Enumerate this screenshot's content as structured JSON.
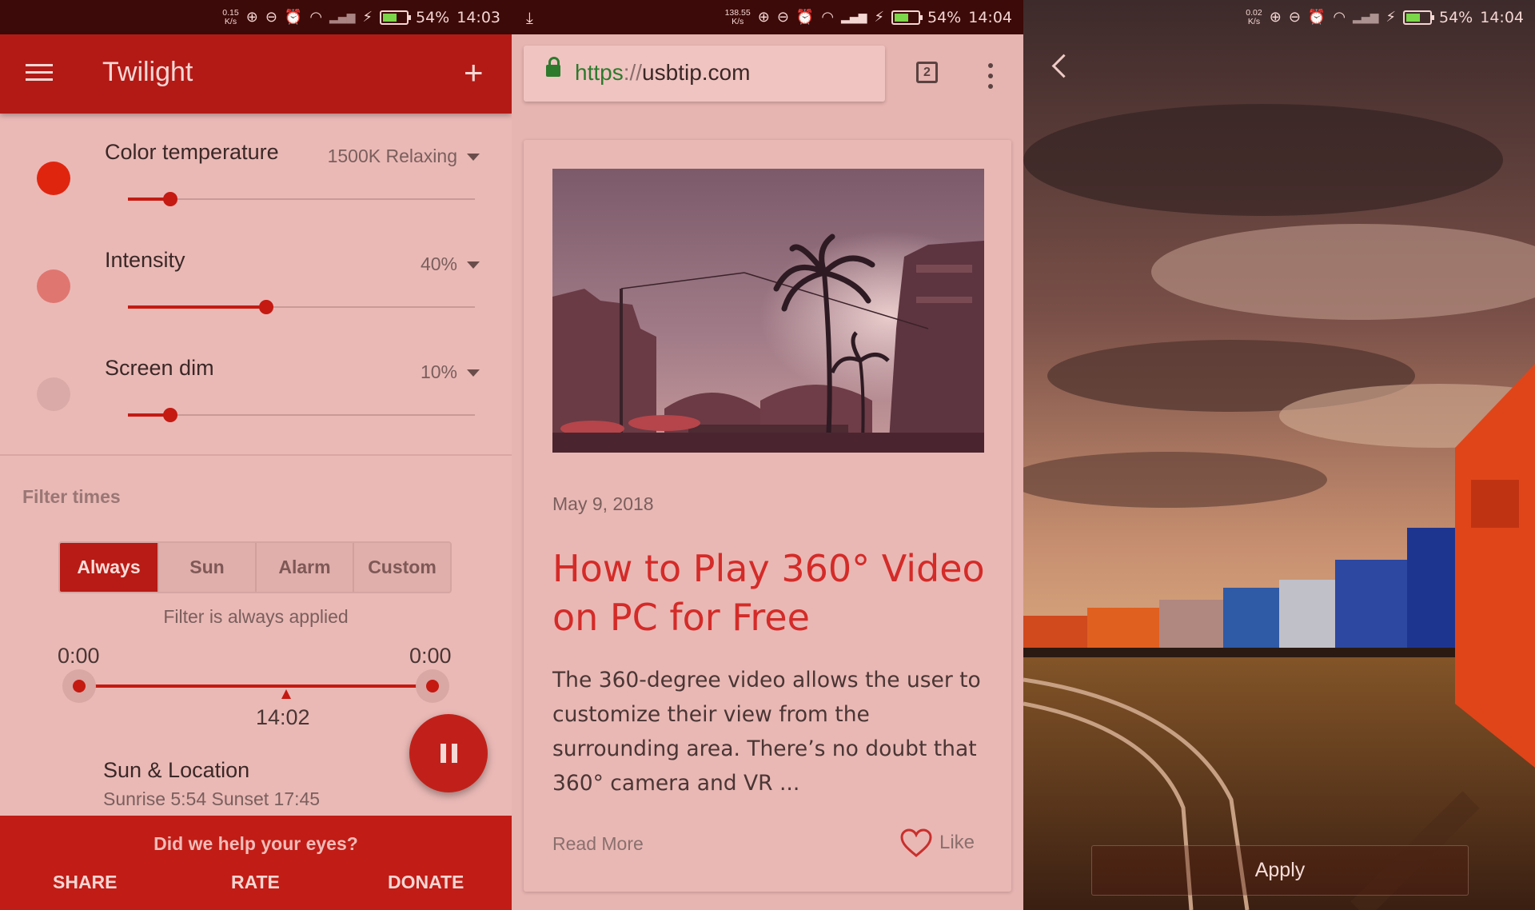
{
  "status_bars": [
    {
      "speed_top": "0.15",
      "speed_bottom": "K/s",
      "battery": "54%",
      "time": "14:03",
      "battery_level": 0.54
    },
    {
      "speed_top": "138.55",
      "speed_bottom": "K/s",
      "battery": "54%",
      "time": "14:04",
      "battery_level": 0.54
    },
    {
      "speed_top": "0.02",
      "speed_bottom": "K/s",
      "battery": "54%",
      "time": "14:04",
      "battery_level": 0.54
    }
  ],
  "twilight": {
    "title": "Twilight",
    "sliders": [
      {
        "label": "Color temperature",
        "value": "1500K Relaxing",
        "level": 0.1,
        "dot_color": "#e0250f"
      },
      {
        "label": "Intensity",
        "value": "40%",
        "level": 0.4,
        "dot_color": "#e07670"
      },
      {
        "label": "Screen dim",
        "value": "10%",
        "level": 0.1,
        "dot_color": "#d9aaa7"
      }
    ],
    "filter_times_title": "Filter times",
    "modes": [
      "Always",
      "Sun",
      "Alarm",
      "Custom"
    ],
    "active_mode": "Always",
    "filter_desc": "Filter is always applied",
    "start_time": "0:00",
    "end_time": "0:00",
    "current_time": "14:02",
    "sun_title": "Sun & Location",
    "sun_sub": "Sunrise 5:54 Sunset 17:45",
    "bottom_question": "Did we help your eyes?",
    "share": "SHARE",
    "rate": "RATE",
    "donate": "DONATE",
    "accent": "#b31a16"
  },
  "browser": {
    "url_scheme": "https",
    "url_sep": "://",
    "url_host": "usbtip.com",
    "tab_count": "2",
    "post_date": "May 9, 2018",
    "post_title": "How to Play 360° Video on PC for Free",
    "post_excerpt": "The 360-degree video allows the user to customize their view from the surrounding area. There’s no doubt that 360° camera and VR ...",
    "read_more": "Read More",
    "like": "Like",
    "title_color": "#d42b28"
  },
  "wallpaper": {
    "apply": "Apply"
  }
}
